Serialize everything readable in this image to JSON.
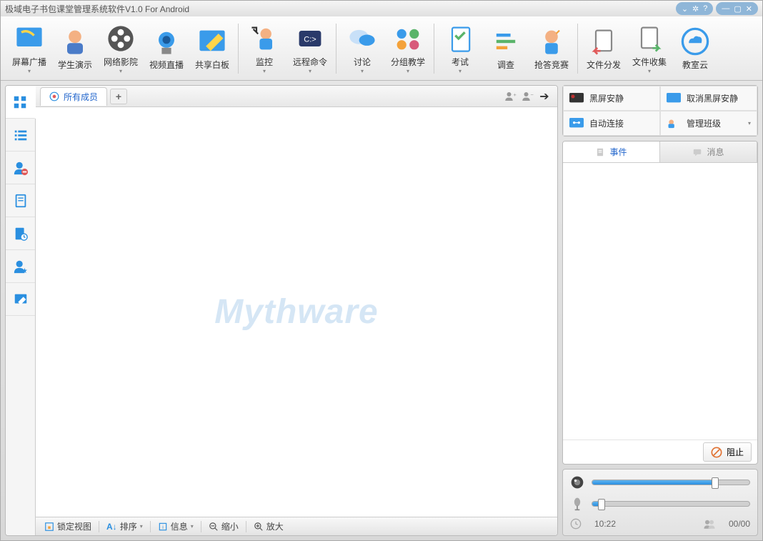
{
  "title": "极域电子书包课堂管理系统软件V1.0 For Android",
  "toolbar": {
    "items": [
      {
        "label": "屏幕广播",
        "icon": "broadcast"
      },
      {
        "label": "学生演示",
        "icon": "student"
      },
      {
        "label": "网络影院",
        "icon": "film"
      },
      {
        "label": "视频直播",
        "icon": "camera"
      },
      {
        "label": "共享白板",
        "icon": "whiteboard"
      }
    ],
    "group2": [
      {
        "label": "监控",
        "icon": "monitor"
      },
      {
        "label": "远程命令",
        "icon": "remote"
      }
    ],
    "group3": [
      {
        "label": "讨论",
        "icon": "chat"
      },
      {
        "label": "分组教学",
        "icon": "group"
      }
    ],
    "group4": [
      {
        "label": "考试",
        "icon": "exam"
      },
      {
        "label": "调查",
        "icon": "survey"
      },
      {
        "label": "抢答竞赛",
        "icon": "quiz"
      }
    ],
    "group5": [
      {
        "label": "文件分发",
        "icon": "send"
      },
      {
        "label": "文件收集",
        "icon": "collect"
      },
      {
        "label": "教室云",
        "icon": "cloud"
      }
    ]
  },
  "members_tab": "所有成员",
  "watermark": "Mythware",
  "statusbar": {
    "lock": "锁定视图",
    "sort": "排序",
    "info": "信息",
    "zoom_out": "缩小",
    "zoom_in": "放大"
  },
  "quick": {
    "black": "黑屏安静",
    "unblack": "取消黑屏安静",
    "auto": "自动连接",
    "manage": "管理班级"
  },
  "events": {
    "tab_events": "事件",
    "tab_msg": "消息",
    "stop": "阻止"
  },
  "audio": {
    "time": "10:22",
    "count": "00/00",
    "speaker_pct": 78,
    "mic_pct": 6
  }
}
